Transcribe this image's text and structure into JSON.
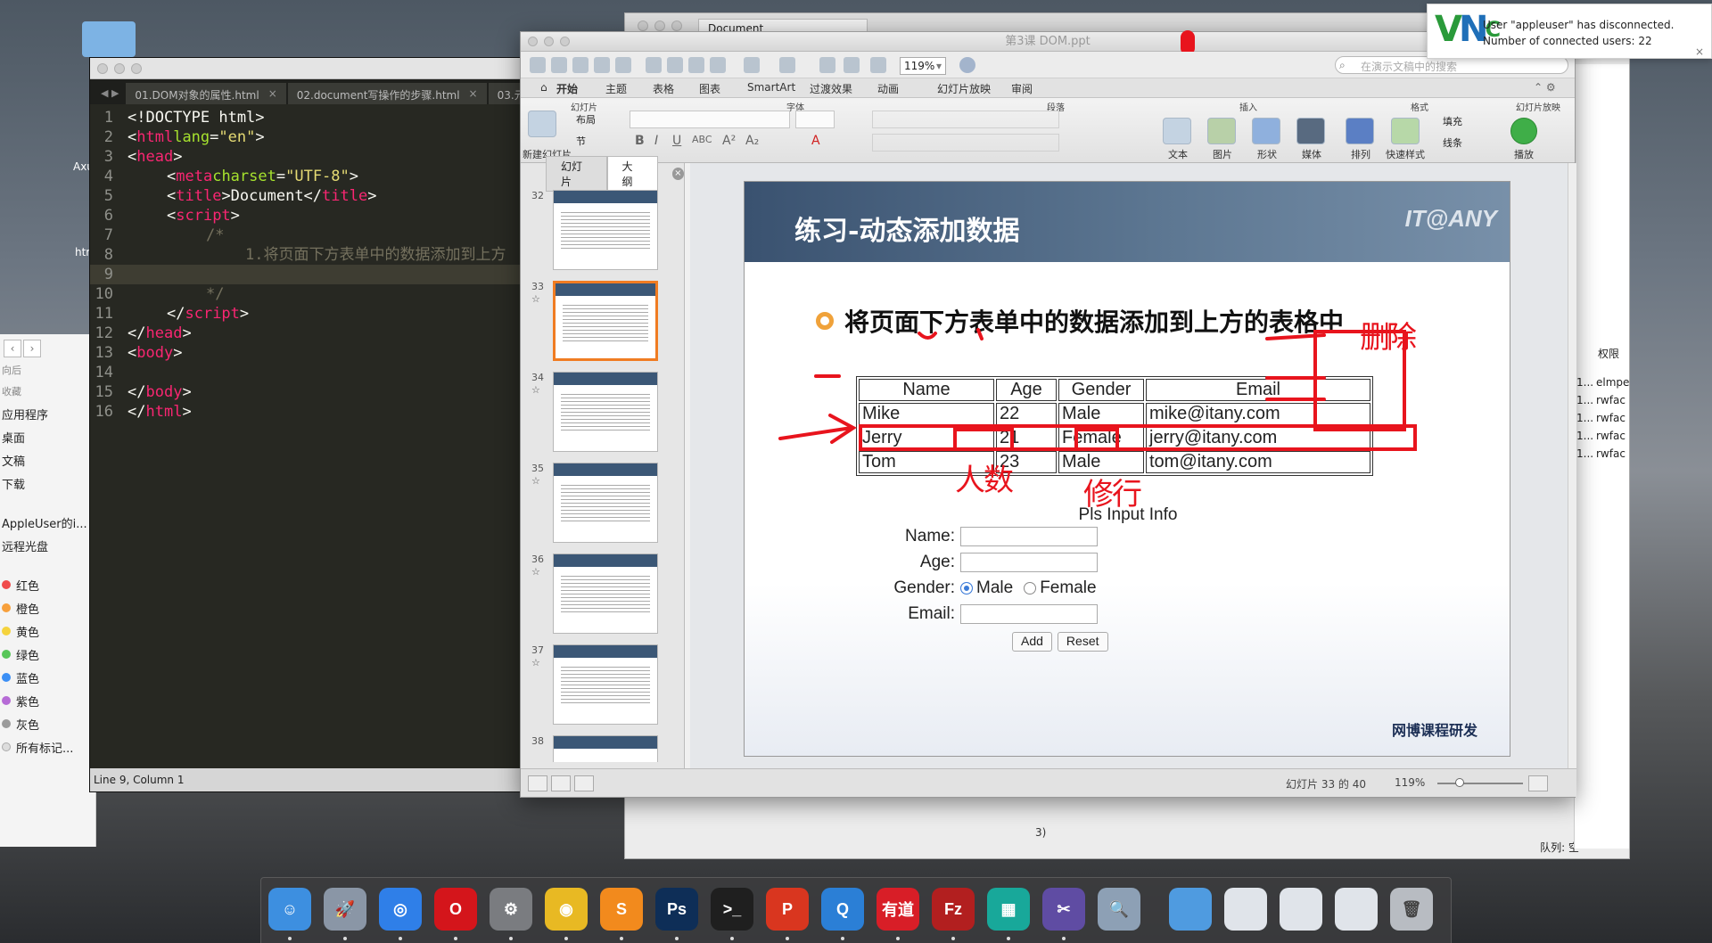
{
  "desktop": {
    "labels": [
      "Axu",
      "htr"
    ]
  },
  "finder": {
    "nav_hint": "向后",
    "section_favorites": "收藏",
    "favorites": [
      "应用程序",
      "桌面",
      "文稿",
      "下载"
    ],
    "section_devices": "",
    "devices": [
      "AppleUser的i...",
      "远程光盘"
    ],
    "section_tags": "",
    "tags": [
      {
        "label": "红色",
        "color": "#f04a4a"
      },
      {
        "label": "橙色",
        "color": "#f7a03c"
      },
      {
        "label": "黄色",
        "color": "#f5d33d"
      },
      {
        "label": "绿色",
        "color": "#58c659"
      },
      {
        "label": "蓝色",
        "color": "#3b8ff5"
      },
      {
        "label": "紫色",
        "color": "#b66bd6"
      },
      {
        "label": "灰色",
        "color": "#9b9b9b"
      }
    ],
    "all_tags": "所有标记..."
  },
  "editor": {
    "tabs": [
      {
        "label": "01.DOM对象的属性.html"
      },
      {
        "label": "02.document写操作的步骤.html"
      },
      {
        "label": "03.元"
      }
    ],
    "tab_close": "×",
    "status": "Line 9, Column 1",
    "lines": {
      "n1": "1",
      "n2": "2",
      "n3": "3",
      "n4": "4",
      "n5": "5",
      "n6": "6",
      "n7": "7",
      "n8": "8",
      "n9": "9",
      "n10": "10",
      "n11": "11",
      "n12": "12",
      "n13": "13",
      "n14": "14",
      "n15": "15",
      "n16": "16",
      "l1": "<!DOCTYPE html>",
      "l2_open": "<",
      "l2_tag": "html",
      "l2_attr": " lang",
      "l2_eq": "=",
      "l2_val": "\"en\"",
      "l2_close": ">",
      "l3_open": "<",
      "l3_tag": "head",
      "l3_close": ">",
      "l4_open": "<",
      "l4_tag": "meta",
      "l4_attr": " charset",
      "l4_eq": "=",
      "l4_val": "\"UTF-8\"",
      "l4_close": ">",
      "l5_open": "<",
      "l5_tag": "title",
      "l5_mid": ">Document</",
      "l5_tag2": "title",
      "l5_close": ">",
      "l6_open": "<",
      "l6_tag": "script",
      "l6_close": ">",
      "l7": "/*",
      "l8": "1.将页面下方表单中的数据添加到上方",
      "l10": "*/",
      "l11_open": "</",
      "l11_tag": "script",
      "l11_close": ">",
      "l12_open": "</",
      "l12_tag": "head",
      "l12_close": ">",
      "l13_open": "<",
      "l13_tag": "body",
      "l13_close": ">",
      "l15_open": "</",
      "l15_tag": "body",
      "l15_close": ">",
      "l16_open": "</",
      "l16_tag": "html",
      "l16_close": ">"
    }
  },
  "background_window": {
    "tab": "Document",
    "right_header": "权限",
    "right_rows": [
      {
        "left": "1...",
        "right": "elmpe"
      },
      {
        "left": "1...",
        "right": "rwfac"
      },
      {
        "left": "1...",
        "right": "rwfac"
      },
      {
        "left": "1...",
        "right": "rwfac"
      },
      {
        "left": "1...",
        "right": "rwfac"
      }
    ],
    "queue_label": "队列: 空",
    "lower_tab_fragment": "3)"
  },
  "powerpoint": {
    "title": "第3课 DOM.ppt",
    "zoom_value": "119%",
    "search_placeholder": "在演示文稿中的搜索",
    "ribbon_tabs": [
      "开始",
      "主题",
      "表格",
      "图表",
      "SmartArt",
      "过渡效果",
      "动画",
      "幻灯片放映",
      "审阅"
    ],
    "groups": [
      "幻灯片",
      "字体",
      "段落",
      "插入",
      "格式",
      "幻灯片放映"
    ],
    "buttons": {
      "new_slide": "新建幻灯片",
      "layout": "布局",
      "section": "节",
      "text": "文本",
      "picture": "图片",
      "shape": "形状",
      "media": "媒体",
      "arrange": "排列",
      "quick_styles": "快速样式",
      "fill": "填充",
      "line": "线条",
      "play": "播放"
    },
    "pane_tabs": {
      "slides": "幻灯片",
      "outline": "大纲"
    },
    "thumbnails": [
      {
        "num": "32",
        "star": ""
      },
      {
        "num": "33",
        "star": "☆"
      },
      {
        "num": "34",
        "star": "☆"
      },
      {
        "num": "35",
        "star": "☆"
      },
      {
        "num": "36",
        "star": "☆"
      },
      {
        "num": "37",
        "star": "☆"
      },
      {
        "num": "38",
        "star": ""
      }
    ],
    "status_slide": "幻灯片 33 的 40",
    "status_zoom": "119%"
  },
  "slide": {
    "title": "练习-动态添加数据",
    "logo": "IT@ANY",
    "bullet": "将页面下方表单中的数据添加到上方的表格中",
    "table_headers": [
      "Name",
      "Age",
      "Gender",
      "Email"
    ],
    "table_rows": [
      [
        "Mike",
        "22",
        "Male",
        "mike@itany.com"
      ],
      [
        "Jerry",
        "21",
        "Female",
        "jerry@itany.com"
      ],
      [
        "Tom",
        "23",
        "Male",
        "tom@itany.com"
      ]
    ],
    "form_title": "Pls Input Info",
    "form_labels": {
      "name": "Name:",
      "age": "Age:",
      "gender": "Gender:",
      "email": "Email:"
    },
    "gender_options": {
      "male": "Male",
      "female": "Female"
    },
    "gender_selected": "Male",
    "add_button": "Add",
    "reset_button": "Reset",
    "footer": "网博课程研发",
    "annotation_color": "#e8141d",
    "annotations": [
      "删",
      "除",
      "人",
      "数",
      "修",
      "行"
    ]
  },
  "vnc": {
    "logo": "VNC",
    "line1": "User \"appleuser\" has disconnected.",
    "line2": "Number of connected users: 22"
  },
  "dock": {
    "apps": [
      {
        "name": "Finder",
        "glyph": "☺",
        "color": "#3d8fe0"
      },
      {
        "name": "Launchpad",
        "glyph": "🚀",
        "color": "#8a96a6"
      },
      {
        "name": "Safari",
        "glyph": "◎",
        "color": "#2f7fe8"
      },
      {
        "name": "Opera",
        "glyph": "O",
        "color": "#d4151b"
      },
      {
        "name": "System Preferences",
        "glyph": "⚙",
        "color": "#7a7c80"
      },
      {
        "name": "Chrome",
        "glyph": "◉",
        "color": "#e8b923"
      },
      {
        "name": "Sublime Text",
        "glyph": "S",
        "color": "#f28a1d"
      },
      {
        "name": "Photoshop",
        "glyph": "Ps",
        "color": "#0e2e57"
      },
      {
        "name": "Terminal",
        "glyph": ">_",
        "color": "#1f1f1f"
      },
      {
        "name": "WPS",
        "glyph": "P",
        "color": "#d9361f"
      },
      {
        "name": "QuickTime",
        "glyph": "Q",
        "color": "#2b7fd6"
      },
      {
        "name": "Youdao",
        "glyph": "有道",
        "color": "#d81e27"
      },
      {
        "name": "FileZilla",
        "glyph": "Fz",
        "color": "#b21f1f"
      },
      {
        "name": "Mosaic",
        "glyph": "▦",
        "color": "#18a89a"
      },
      {
        "name": "Screenshot",
        "glyph": "✂",
        "color": "#5f4ca3"
      },
      {
        "name": "Preview",
        "glyph": "🔍",
        "color": "#8da0b5"
      },
      {
        "name": "Folder",
        "glyph": "",
        "color": "#4f9be0"
      },
      {
        "name": "Window 1",
        "glyph": "",
        "color": "#e0e4ea"
      },
      {
        "name": "Window 2",
        "glyph": "",
        "color": "#e0e4ea"
      },
      {
        "name": "Window 3",
        "glyph": "",
        "color": "#e0e4ea"
      },
      {
        "name": "Trash",
        "glyph": "🗑",
        "color": "#b8bcc2"
      }
    ]
  }
}
